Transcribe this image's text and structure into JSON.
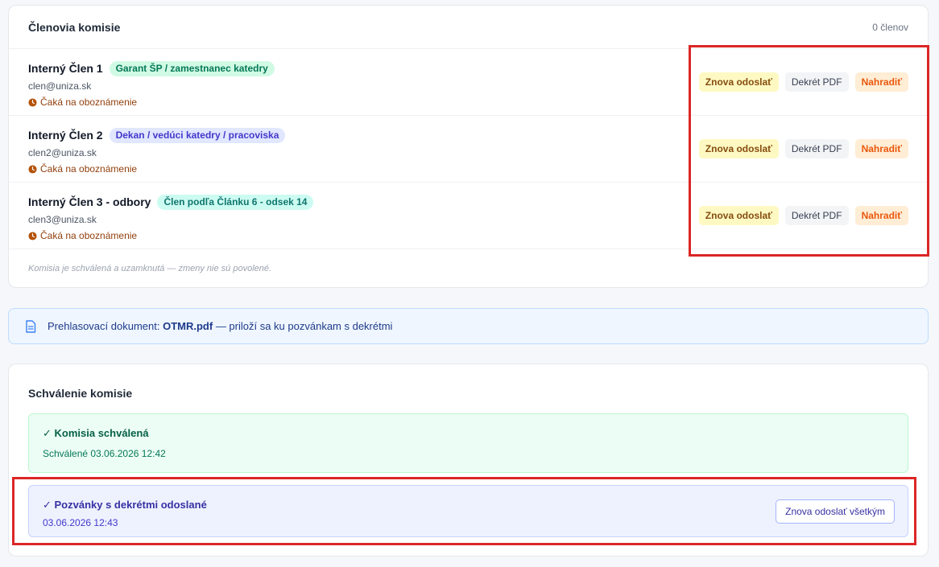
{
  "members_section": {
    "title": "Členovia komisie",
    "count_label": "0 členov",
    "members": [
      {
        "name": "Interný Člen 1",
        "role": "Garant ŠP / zamestnanec katedry",
        "email": "clen@uniza.sk",
        "status": "Čaká na oboznámenie",
        "actions": {
          "resend": "Znova odoslať",
          "pdf": "Dekrét PDF",
          "replace": "Nahradiť"
        }
      },
      {
        "name": "Interný Člen 2",
        "role": "Dekan / vedúci katedry / pracoviska",
        "email": "clen2@uniza.sk",
        "status": "Čaká na oboznámenie",
        "actions": {
          "resend": "Znova odoslať",
          "pdf": "Dekrét PDF",
          "replace": "Nahradiť"
        }
      },
      {
        "name": "Interný Člen 3 - odbory",
        "role": "Člen podľa Článku 6 - odsek 14",
        "email": "clen3@uniza.sk",
        "status": "Čaká na oboznámenie",
        "actions": {
          "resend": "Znova odoslať",
          "pdf": "Dekrét PDF",
          "replace": "Nahradiť"
        }
      }
    ],
    "locked_note": "Komisia je schválená a uzamknutá — zmeny nie sú povolené."
  },
  "document_banner": {
    "prefix": "Prehlasovací dokument:",
    "filename": "OTMR.pdf",
    "suffix": "— priloží sa ku pozvánkam s dekrétmi"
  },
  "approval_section": {
    "title": "Schválenie komisie",
    "approved": {
      "title": "✓ Komisia schválená",
      "subtitle": "Schválené 03.06.2026 12:42"
    },
    "invites": {
      "title": "✓ Pozvánky s dekrétmi odoslané",
      "subtitle": "03.06.2026 12:43",
      "button": "Znova odoslať všetkým"
    }
  },
  "colors": {
    "highlight": "#dc2626",
    "approved_bg": "#ecfdf5",
    "invites_bg": "#eef2ff",
    "banner_bg": "#eff6ff"
  }
}
